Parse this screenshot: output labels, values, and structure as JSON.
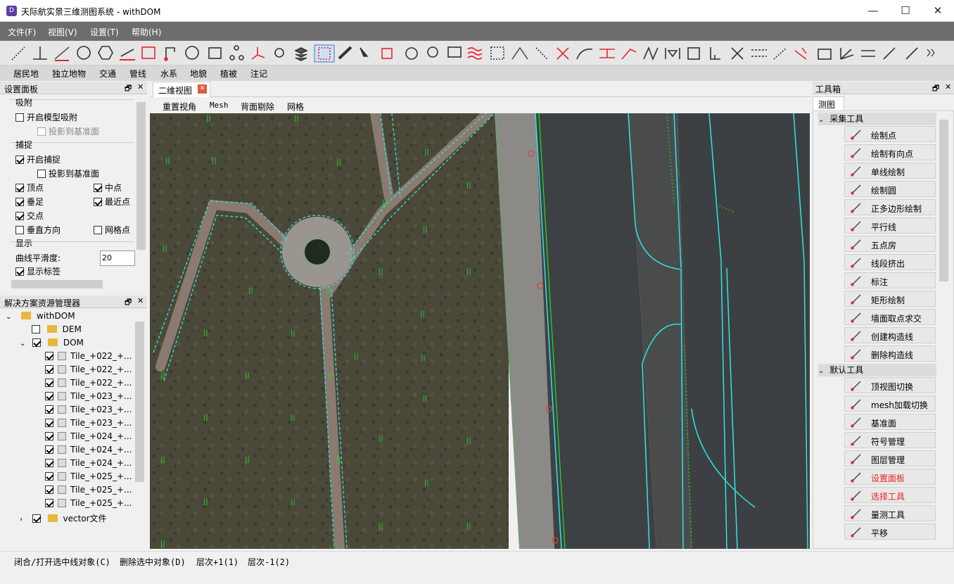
{
  "window": {
    "title": "天际航实景三维测图系统 - withDOM",
    "minimize": "—",
    "maximize": "☐",
    "close": "✕"
  },
  "menu": [
    "文件(F)",
    "视图(V)",
    "设置(T)",
    "帮助(H)"
  ],
  "categories": [
    "居民地",
    "独立地物",
    "交通",
    "管线",
    "水系",
    "地貌",
    "植被",
    "注记"
  ],
  "settings_panel": {
    "title": "设置面板",
    "snap_group": "吸附",
    "enable_model_snap": "开启模型吸附",
    "project_to_base_1": "投影到基准面",
    "capture_group": "捕捉",
    "enable_capture": "开启捕捉",
    "project_to_base_2": "投影到基准面",
    "vertex": "顶点",
    "midpoint": "中点",
    "perpendicular": "垂足",
    "nearest": "最近点",
    "intersection": "交点",
    "vertical_dir": "垂直方向",
    "grid_point": "网格点",
    "display_group": "显示",
    "smooth_label": "曲线平滑度:",
    "smooth_value": "20",
    "show_label": "显示标签"
  },
  "solution_panel": {
    "title": "解决方案资源管理器",
    "root": "withDOM",
    "dem": "DEM",
    "dom": "DOM",
    "tiles": [
      "Tile_+022_+...",
      "Tile_+022_+...",
      "Tile_+022_+...",
      "Tile_+023_+...",
      "Tile_+023_+...",
      "Tile_+023_+...",
      "Tile_+024_+...",
      "Tile_+024_+...",
      "Tile_+024_+...",
      "Tile_+025_+...",
      "Tile_+025_+...",
      "Tile_+025_+..."
    ],
    "vector": "vector文件"
  },
  "view": {
    "tab": "二维视图",
    "toolbar": [
      "重置视角",
      "Mesh",
      "背面剔除",
      "网格"
    ]
  },
  "toolbox": {
    "title": "工具箱",
    "tab": "测图",
    "group_collect": "采集工具",
    "collect_items": [
      {
        "label": "绘制点",
        "icon": "draw-point-icon"
      },
      {
        "label": "绘制有向点",
        "icon": "directed-point-icon"
      },
      {
        "label": "单线绘制",
        "icon": "single-line-icon"
      },
      {
        "label": "绘制圆",
        "icon": "circle-icon"
      },
      {
        "label": "正多边形绘制",
        "icon": "polygon-icon"
      },
      {
        "label": "平行线",
        "icon": "parallel-line-icon"
      },
      {
        "label": "五点房",
        "icon": "five-point-house-icon"
      },
      {
        "label": "线段挤出",
        "icon": "extrude-icon"
      },
      {
        "label": "标注",
        "icon": "annotation-icon"
      },
      {
        "label": "矩形绘制",
        "icon": "rectangle-icon"
      },
      {
        "label": "墙面取点求交",
        "icon": "wall-intersect-icon"
      },
      {
        "label": "创建构造线",
        "icon": "construct-line-icon"
      },
      {
        "label": "删除构造线",
        "icon": "delete-construct-line-icon"
      }
    ],
    "group_default": "默认工具",
    "default_items": [
      {
        "label": "顶视图切换",
        "icon": "top-view-icon"
      },
      {
        "label": "mesh加载切换",
        "icon": "mesh-icon"
      },
      {
        "label": "基准面",
        "icon": "base-plane-icon"
      },
      {
        "label": "符号管理",
        "icon": "symbol-icon"
      },
      {
        "label": "图层管理",
        "icon": "layers-icon"
      },
      {
        "label": "设置面板",
        "icon": "settings-icon"
      },
      {
        "label": "选择工具",
        "icon": "select-icon"
      },
      {
        "label": "量测工具",
        "icon": "ruler-icon"
      },
      {
        "label": "平移",
        "icon": "pan-icon"
      }
    ]
  },
  "status": [
    "闭合/打开选中线对象(C)",
    "删除选中对象(D)",
    "层次+1(1)",
    "层次-1(2)"
  ],
  "colors": {
    "accent_red": "#e8262b",
    "cyan_line": "#2ee6e6",
    "green_dots": "#22dd22"
  }
}
